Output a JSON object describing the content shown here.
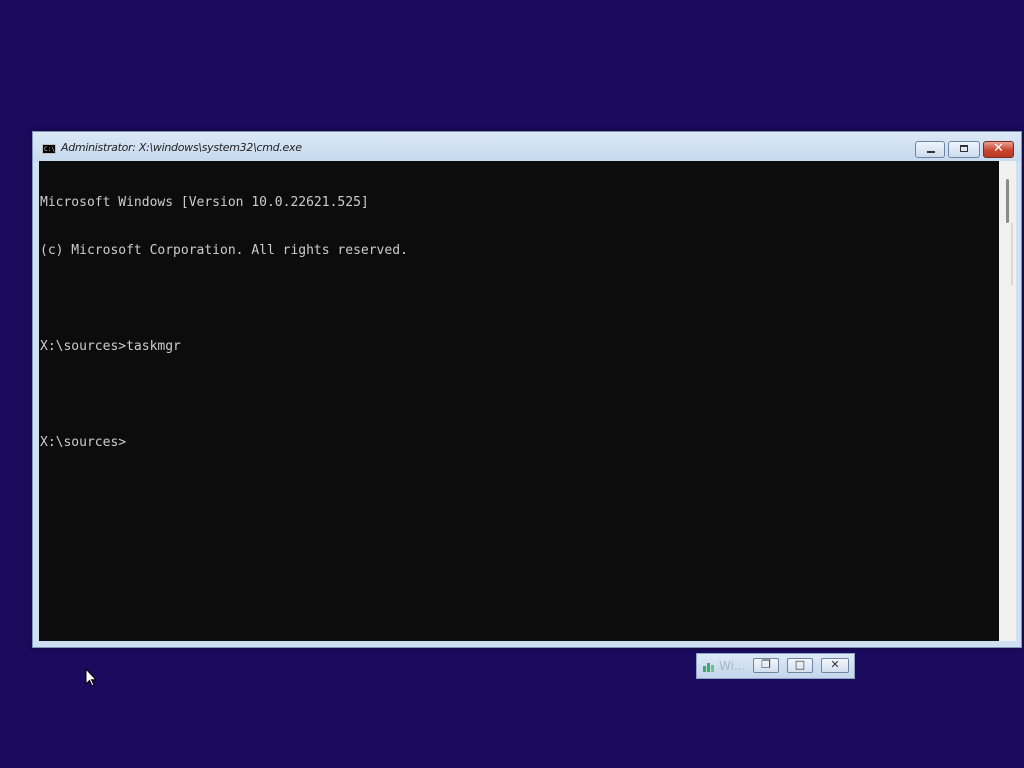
{
  "window": {
    "title": "Administrator: X:\\windows\\system32\\cmd.exe",
    "icon": "cmd-icon",
    "icon_label": "C:\\."
  },
  "console": {
    "lines": [
      "Microsoft Windows [Version 10.0.22621.525]",
      "(c) Microsoft Corporation. All rights reserved.",
      "",
      "X:\\sources>taskmgr",
      "",
      "X:\\sources>"
    ]
  },
  "minimized_window": {
    "title": "Wi...",
    "icon": "task-manager-icon"
  },
  "colors": {
    "desktop": "#1b0b5e",
    "console_bg": "#0c0c0c",
    "console_fg": "#cccccc",
    "close_button": "#c8442e"
  }
}
